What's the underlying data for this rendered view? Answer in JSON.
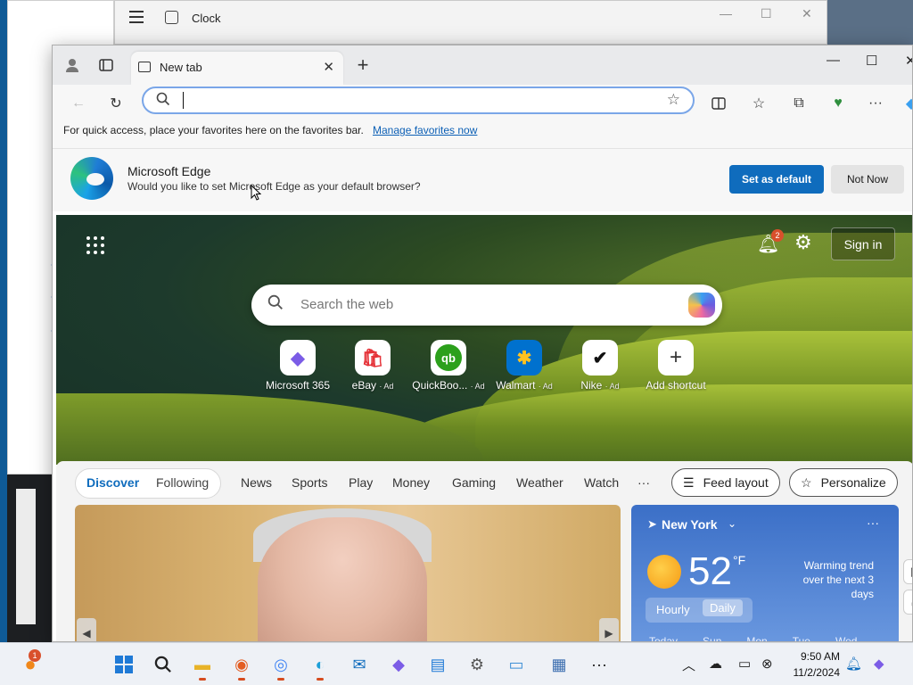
{
  "clock_window": {
    "title": "Clock",
    "minimize": "—",
    "maximize": "☐",
    "close": "✕"
  },
  "edge": {
    "tab": {
      "title": "New tab",
      "close": "✕"
    },
    "new_tab": "+",
    "window_controls": {
      "minimize": "—",
      "maximize": "☐",
      "close": "✕"
    },
    "address": {
      "value": "",
      "placeholder": ""
    },
    "favorites_bar": {
      "text": "For quick access, place your favorites here on the favorites bar.",
      "link": "Manage favorites now"
    },
    "default_prompt": {
      "title": "Microsoft Edge",
      "subtitle": "Would you like to set Microsoft Edge as your default browser?",
      "primary": "Set as default",
      "secondary": "Not Now"
    }
  },
  "newtab": {
    "notifications_count": "2",
    "sign_in": "Sign in",
    "search_placeholder": "Search the web",
    "shortcuts": [
      {
        "label": "Microsoft 365",
        "ad": "",
        "glyph": "◆",
        "color": "#7b5ce6"
      },
      {
        "label": "eBay",
        "ad": "· Ad",
        "glyph": "🛍",
        "color": "#e53238"
      },
      {
        "label": "QuickBoo...",
        "ad": "· Ad",
        "glyph": "qb",
        "color": "#2ca01c"
      },
      {
        "label": "Walmart",
        "ad": "· Ad",
        "glyph": "✱",
        "color": "#ffc220"
      },
      {
        "label": "Nike",
        "ad": "· Ad",
        "glyph": "✔",
        "color": "#111111"
      },
      {
        "label": "Add shortcut",
        "ad": "",
        "glyph": "+",
        "color": "#333333"
      }
    ],
    "feed_pills": [
      "Discover",
      "Following"
    ],
    "feed_tabs": [
      "News",
      "Sports",
      "Play",
      "Money",
      "Gaming",
      "Weather",
      "Watch"
    ],
    "more": "···",
    "feed_layout": "Feed layout",
    "personalize": "Personalize",
    "weather": {
      "location": "New York",
      "temp": "52",
      "unit": "°F",
      "trend_title": "Warming trend",
      "trend_sub": "over the next 3 days",
      "tabs": [
        "Hourly",
        "Daily"
      ],
      "days": [
        "Today",
        "Sun",
        "Mon",
        "Tue",
        "Wed"
      ]
    }
  },
  "taskbar": {
    "notification_badge": "1",
    "time": "9:50 AM",
    "date": "11/2/2024"
  },
  "colors": {
    "accent": "#0f6cbd",
    "link": "#0b5fb5"
  }
}
